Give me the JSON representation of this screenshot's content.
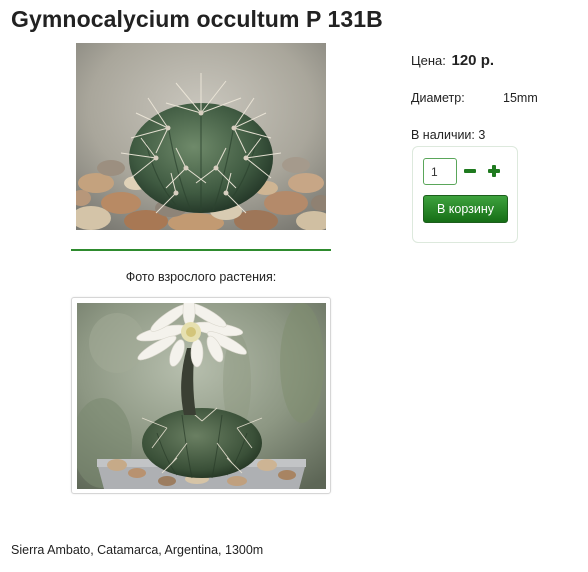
{
  "product": {
    "title": "Gymnocalycium occultum P 131B"
  },
  "gallery": {
    "adult_caption": "Фото взрослого растения:"
  },
  "details": {
    "price_label": "Цена:",
    "price_value": "120 р.",
    "diameter_label": "Диаметр:",
    "diameter_value": "15mm",
    "stock_text": "В наличии: 3"
  },
  "cart": {
    "quantity": "1",
    "add_button_label": "В корзину"
  },
  "description": {
    "locality": "Sierra Ambato, Catamarca, Argentina, 1300m"
  },
  "colors": {
    "accent_green": "#2e8b2e",
    "button_green": "#1f7a1f"
  }
}
